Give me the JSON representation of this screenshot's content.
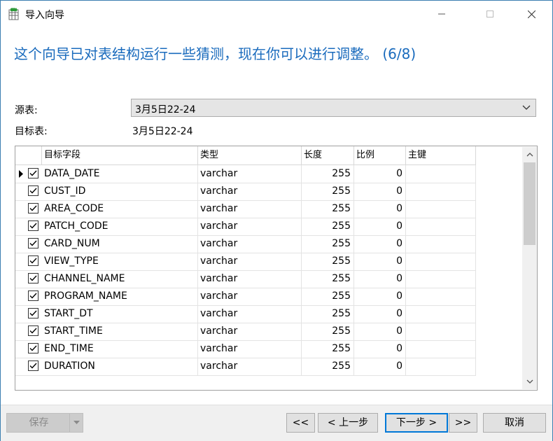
{
  "window": {
    "title": "导入向导",
    "minimize_icon": "minimize-icon",
    "maximize_icon": "maximize-icon",
    "close_icon": "close-icon"
  },
  "heading": "这个向导已对表结构运行一些猜测，现在你可以进行调整。 (6/8)",
  "form": {
    "source_label": "源表:",
    "source_value": "3月5日22-24",
    "target_label": "目标表:",
    "target_value": "3月5日22-24"
  },
  "grid": {
    "columns": [
      "目标字段",
      "类型",
      "长度",
      "比例",
      "主键"
    ],
    "rows": [
      {
        "field": "DATA_DATE",
        "type": "varchar",
        "length": "255",
        "scale": "0",
        "pk": "",
        "checked": true
      },
      {
        "field": "CUST_ID",
        "type": "varchar",
        "length": "255",
        "scale": "0",
        "pk": "",
        "checked": true
      },
      {
        "field": "AREA_CODE",
        "type": "varchar",
        "length": "255",
        "scale": "0",
        "pk": "",
        "checked": true
      },
      {
        "field": "PATCH_CODE",
        "type": "varchar",
        "length": "255",
        "scale": "0",
        "pk": "",
        "checked": true
      },
      {
        "field": "CARD_NUM",
        "type": "varchar",
        "length": "255",
        "scale": "0",
        "pk": "",
        "checked": true
      },
      {
        "field": "VIEW_TYPE",
        "type": "varchar",
        "length": "255",
        "scale": "0",
        "pk": "",
        "checked": true
      },
      {
        "field": "CHANNEL_NAME",
        "type": "varchar",
        "length": "255",
        "scale": "0",
        "pk": "",
        "checked": true
      },
      {
        "field": "PROGRAM_NAME",
        "type": "varchar",
        "length": "255",
        "scale": "0",
        "pk": "",
        "checked": true
      },
      {
        "field": "START_DT",
        "type": "varchar",
        "length": "255",
        "scale": "0",
        "pk": "",
        "checked": true
      },
      {
        "field": "START_TIME",
        "type": "varchar",
        "length": "255",
        "scale": "0",
        "pk": "",
        "checked": true
      },
      {
        "field": "END_TIME",
        "type": "varchar",
        "length": "255",
        "scale": "0",
        "pk": "",
        "checked": true
      },
      {
        "field": "DURATION",
        "type": "varchar",
        "length": "255",
        "scale": "0",
        "pk": "",
        "checked": true
      }
    ]
  },
  "footer": {
    "save": "保存",
    "first": "<<",
    "prev": "< 上一步",
    "next": "下一步 >",
    "last": ">>",
    "cancel": "取消"
  },
  "colors": {
    "heading": "#1a6bbd",
    "accent": "#0078d7"
  }
}
